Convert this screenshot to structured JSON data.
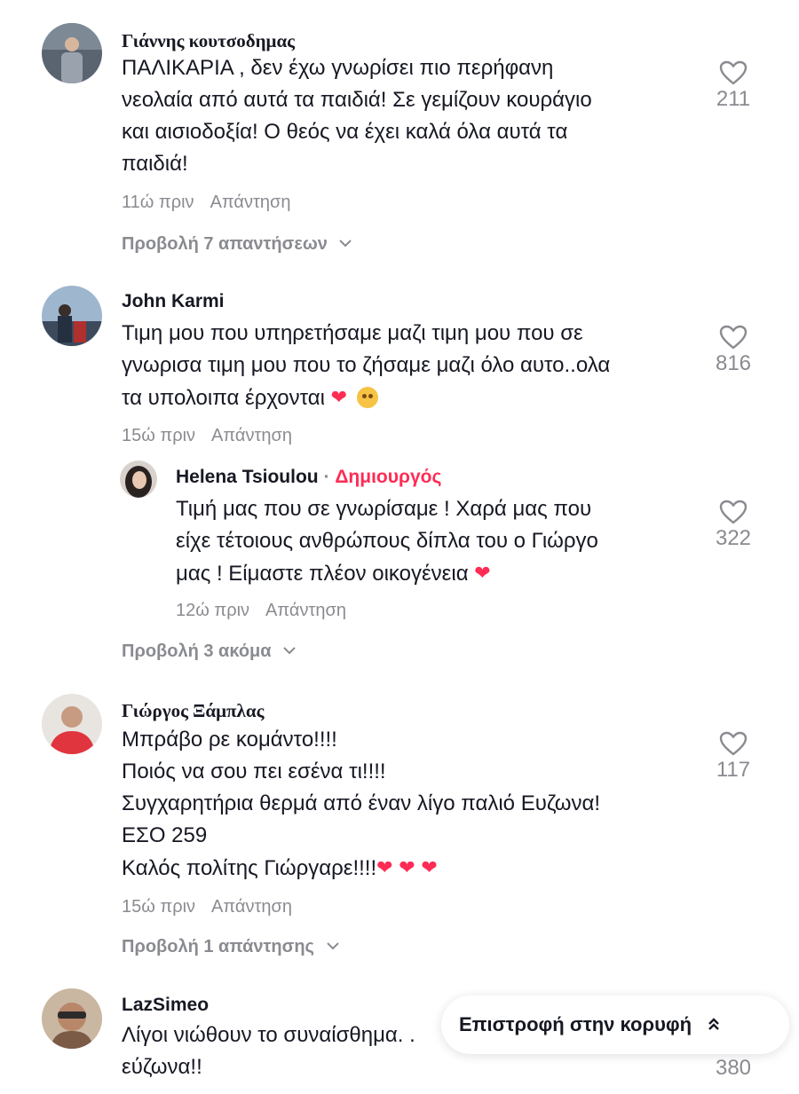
{
  "comments": [
    {
      "username": "Γιάννης κουτσοδημας",
      "text_lines": [
        "ΠΑΛΙΚΑΡΙΑ , δεν έχω γνωρίσει πιο περήφανη",
        "νεολαία από αυτά τα παιδιά! Σε γεμίζουν κουράγιο",
        "και αισιοδοξία! Ο θεός να έχει καλά όλα αυτά τα",
        "παιδιά!"
      ],
      "time": "11ώ πριν",
      "reply_label": "Απάντηση",
      "likes": "211",
      "view_more": "Προβολή 7 απαντήσεων"
    },
    {
      "username": "John Karmi",
      "text_lines": [
        "Τιμη μου που υπηρετήσαμε μαζι τιμη μου που σε",
        "γνωρισα τιμη μου που το ζήσαμε μαζι όλο αυτο..ολα",
        "τα υπολοιπα έρχονται"
      ],
      "time": "15ώ πριν",
      "reply_label": "Απάντηση",
      "likes": "816",
      "reply": {
        "username": "Helena Tsioulou",
        "separator": " · ",
        "badge": "Δημιουργός",
        "text_lines": [
          "Τιμή μας που σε γνωρίσαμε ! Χαρά μας που",
          "είχε τέτοιους ανθρώπους δίπλα του ο Γιώργο",
          "μας ! Είμαστε πλέον οικογένεια"
        ],
        "time": "12ώ πριν",
        "reply_label": "Απάντηση",
        "likes": "322"
      },
      "view_more": "Προβολή 3 ακόμα"
    },
    {
      "username": "Γιώργος Ξάμπλας",
      "text_lines": [
        "Μπράβο ρε κομάντο!!!!",
        "Ποιός να σου πει εσένα τι!!!!",
        "Συγχαρητήρια θερμά από έναν λίγο παλιό Ευζωνα!",
        "ΕΣΟ 259",
        "Καλός πολίτης Γιώργαρε!!!!"
      ],
      "time": "15ώ πριν",
      "reply_label": "Απάντηση",
      "likes": "117",
      "view_more": "Προβολή 1 απάντησης"
    },
    {
      "username": "LazSimeo",
      "text_lines": [
        "Λίγοι νιώθουν το συναίσθημα. .",
        "εύζωνα!!"
      ],
      "likes": "380"
    }
  ],
  "back_to_top": {
    "label": "Επιστροφή στην κορυφή",
    "icon": "double-chevron-up-icon"
  },
  "colors": {
    "creator_badge": "#fe2c55",
    "heart_emoji": "#fe2c55",
    "muted": "#8a8b91"
  }
}
